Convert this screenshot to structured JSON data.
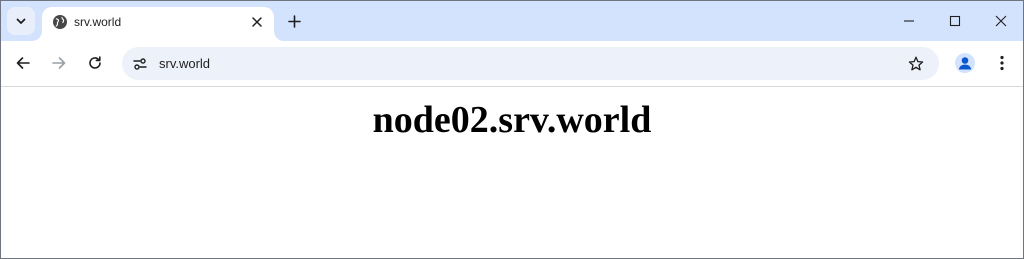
{
  "tab": {
    "title": "srv.world",
    "favicon": "globe-icon"
  },
  "toolbar": {
    "url": "srv.world"
  },
  "page": {
    "heading": "node02.srv.world"
  },
  "colors": {
    "tabstrip_bg": "#d3e3fd",
    "omnibox_bg": "#edf1f9",
    "profile_accent": "#0b57d0"
  }
}
